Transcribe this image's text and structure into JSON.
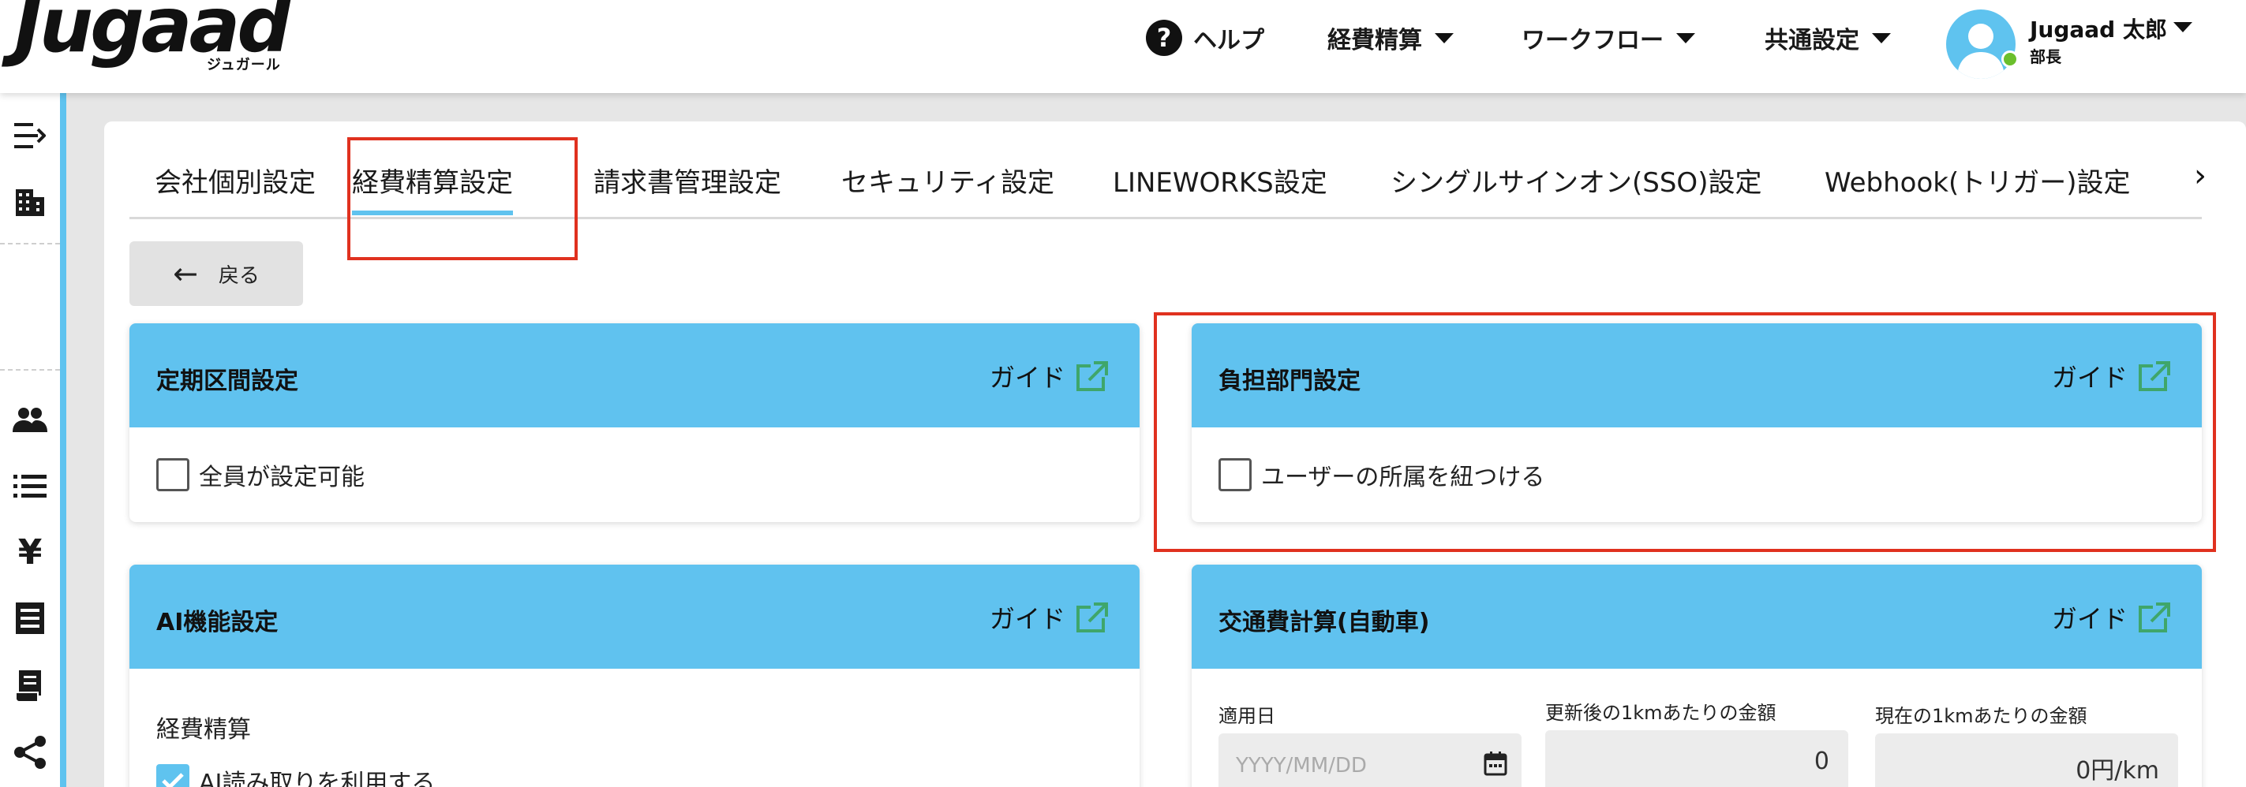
{
  "app": {
    "logo": "Jugaad",
    "logo_sub": "ジュガール"
  },
  "header": {
    "help": "ヘルプ",
    "menus": [
      {
        "label": "経費精算"
      },
      {
        "label": "ワークフロー"
      },
      {
        "label": "共通設定"
      }
    ],
    "user": {
      "name": "Jugaad 太郎",
      "role": "部長",
      "status_color": "#6bbf2c"
    }
  },
  "tabs": [
    {
      "label": "会社個別設定"
    },
    {
      "label": "経費精算設定",
      "active": true
    },
    {
      "label": "請求書管理設定"
    },
    {
      "label": "セキュリティ設定"
    },
    {
      "label": "LINEWORKS設定"
    },
    {
      "label": "シングルサインオン(SSO)設定"
    },
    {
      "label": "Webhook(トリガー)設定"
    }
  ],
  "tab_next": "›",
  "back_label": "戻る",
  "guide_label": "ガイド",
  "cards": {
    "commute": {
      "title": "定期区間設定",
      "checkbox_label": "全員が設定可能",
      "checked": false
    },
    "department": {
      "title": "負担部門設定",
      "checkbox_label": "ユーザーの所属を紐つける",
      "checked": false
    },
    "ai": {
      "title": "AI機能設定",
      "section": "経費精算",
      "checkbox_label": "AI読み取りを利用する",
      "checked": true
    },
    "car": {
      "title": "交通費計算(自動車)",
      "date_label": "適用日",
      "date_placeholder": "YYYY/MM/DD",
      "new_rate_label": "更新後の1kmあたりの金額",
      "new_rate_value": "0",
      "current_rate_label": "現在の1kmあたりの金額",
      "current_rate_value": "0円/km"
    }
  },
  "colors": {
    "accent": "#5fc3ef",
    "card_header": "#60c2ef",
    "highlight": "#e0311f",
    "external_icon": "#3fa66b"
  }
}
